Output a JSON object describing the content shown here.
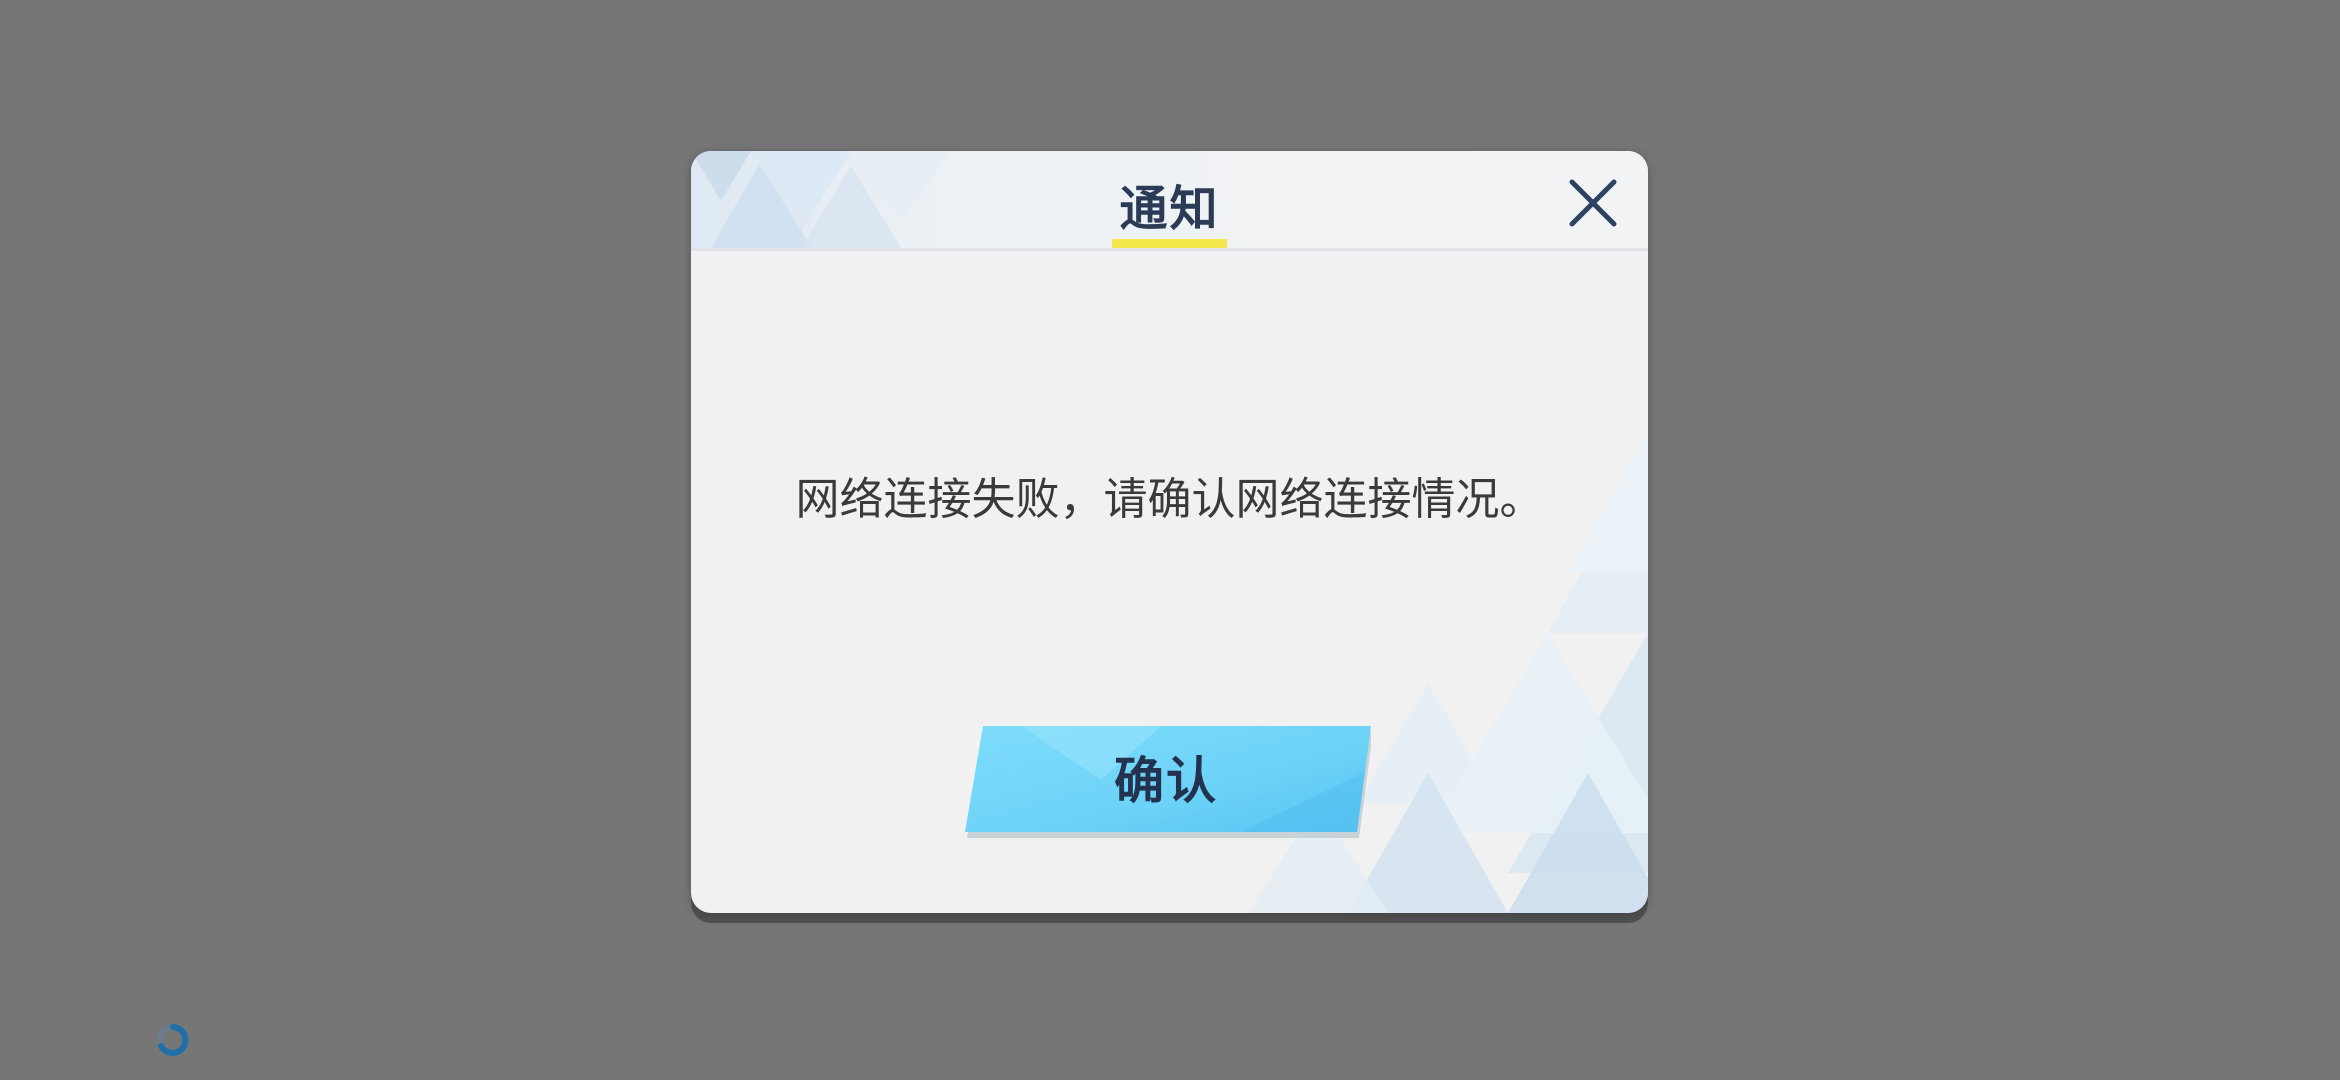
{
  "dialog": {
    "title": "通知",
    "message": "网络连接失败，请确认网络连接情况。",
    "confirm_label": "确认",
    "close_icon": "close-icon"
  },
  "loading": {
    "icon": "loading-spinner-icon"
  },
  "colors": {
    "background": "#767676",
    "dialog": "#f1f1f1",
    "title_text": "#2b3a55",
    "title_underline": "#f4e84d",
    "button": "#6ed3f6",
    "spinner": "#1f6fa8"
  }
}
